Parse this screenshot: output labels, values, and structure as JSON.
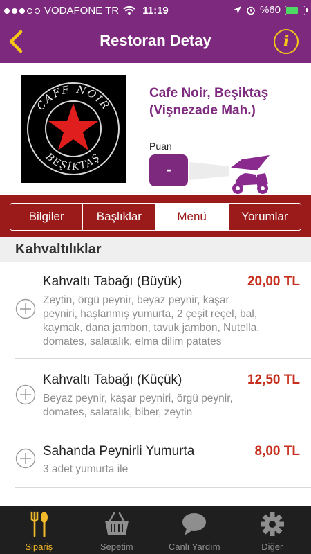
{
  "status_bar": {
    "carrier": "VODAFONE TR",
    "time": "11:19",
    "battery": "%60",
    "battery_level": 0.6,
    "signal_bars": 3
  },
  "nav": {
    "title": "Restoran Detay",
    "info_label": "i",
    "back_icon": "chevron-left-icon",
    "accent": "#7d2a7e",
    "icon_color": "#f5c518"
  },
  "restaurant": {
    "name": "Cafe Noir, Beşiktaş (Vişnezade Mah.)",
    "logo_top_text": "CAFE NOIR",
    "logo_bottom_text": "BEŞİKTAŞ",
    "rating_label": "Puan",
    "rating_value": "-"
  },
  "tabs": {
    "items": [
      "Bilgiler",
      "Başlıklar",
      "Menü",
      "Yorumlar"
    ],
    "active": "Menü",
    "band_color": "#9b1b1b"
  },
  "menu": {
    "section_title": "Kahvaltılıklar",
    "items": [
      {
        "name": "Kahvaltı Tabağı (Büyük)",
        "price": "20,00 TL",
        "desc_lines": [
          "Zeytin, örgü peynir, beyaz peynir, kaşar",
          "peyniri, haşlanmış yumurta, 2 çeşit reçel, bal,",
          "kaymak, dana jambon, tavuk jambon, Nutella,",
          "domates, salatalık, elma dilim patates"
        ]
      },
      {
        "name": "Kahvaltı Tabağı (Küçük)",
        "price": "12,50 TL",
        "desc_lines": [
          "Beyaz peynir, kaşar peyniri, örgü peynir,",
          "domates, salatalık, biber, zeytin"
        ]
      },
      {
        "name": "Sahanda Peynirli Yumurta",
        "price": "8,00 TL",
        "desc_lines": [
          "3 adet yumurta ile"
        ]
      }
    ],
    "price_color": "#c62f1d"
  },
  "tab_bar": {
    "items": [
      {
        "label": "Sipariş",
        "icon": "fork-spoon-icon"
      },
      {
        "label": "Sepetim",
        "icon": "basket-icon"
      },
      {
        "label": "Canlı Yardım",
        "icon": "chat-bubble-icon"
      },
      {
        "label": "Diğer",
        "icon": "gear-icon"
      }
    ],
    "active": "Sipariş",
    "active_color": "#f2b92a"
  }
}
